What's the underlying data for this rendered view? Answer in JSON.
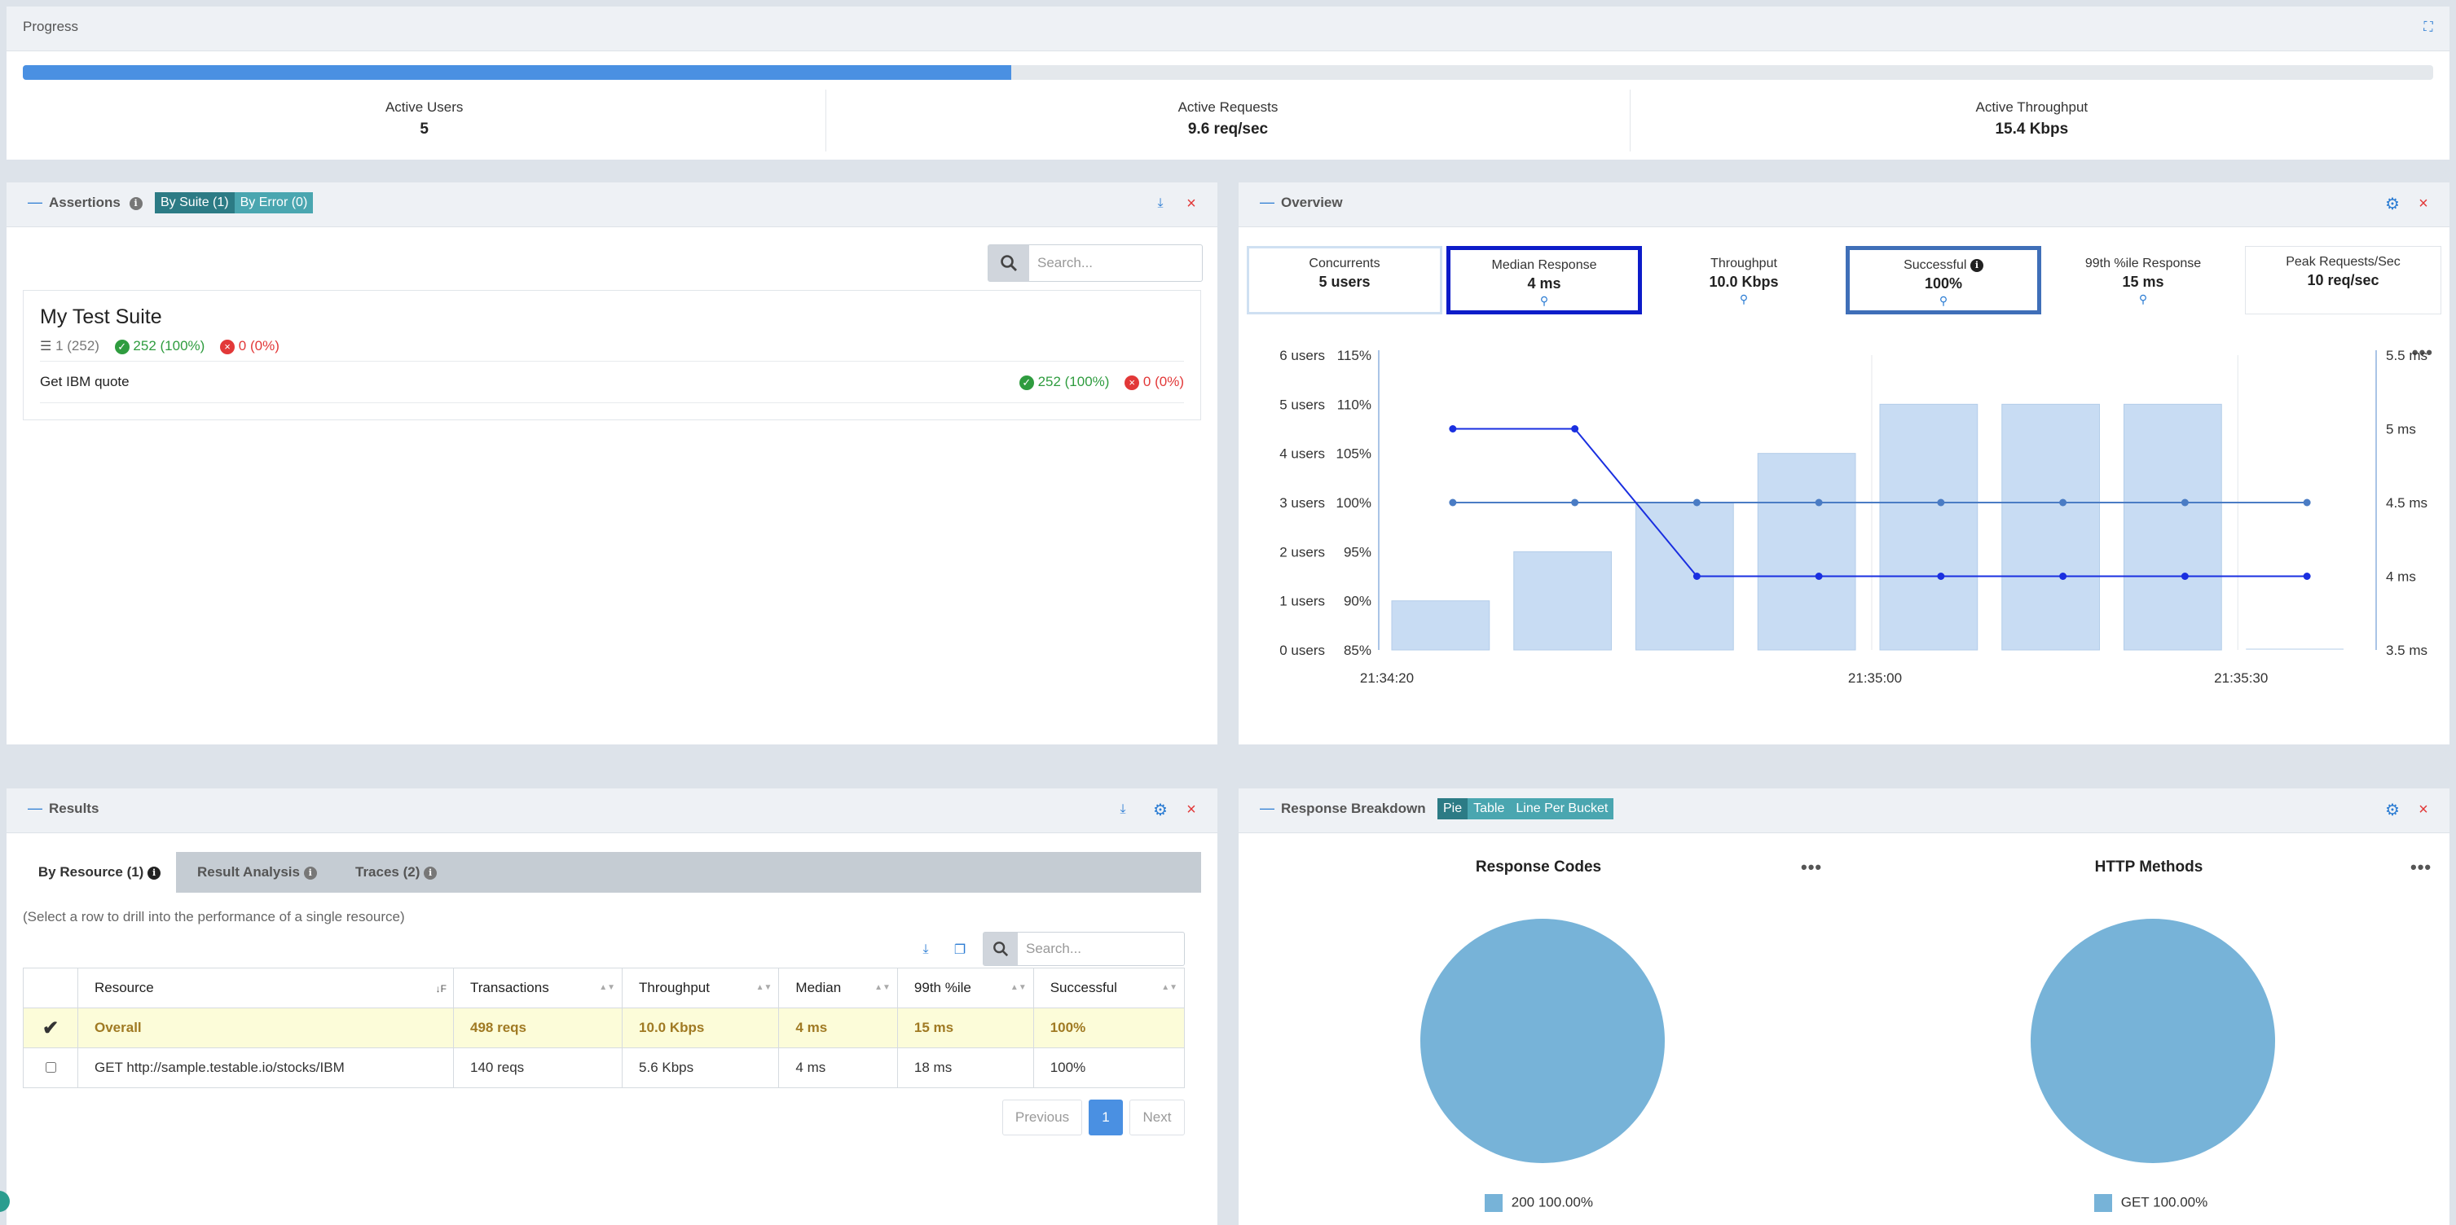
{
  "progress": {
    "title": "Progress",
    "fill_fraction": 0.41,
    "stats": [
      {
        "label": "Active Users",
        "value": "5"
      },
      {
        "label": "Active Requests",
        "value": "9.6 req/sec"
      },
      {
        "label": "Active Throughput",
        "value": "15.4 Kbps"
      }
    ]
  },
  "assertions": {
    "title": "Assertions",
    "toggle": [
      "By Suite (1)",
      "By Error (0)"
    ],
    "search_placeholder": "Search...",
    "suite": {
      "name": "My Test Suite",
      "count": "1 (252)",
      "pass": "252 (100%)",
      "fail": "0 (0%)"
    },
    "rows": [
      {
        "name": "Get IBM quote",
        "pass": "252 (100%)",
        "fail": "0 (0%)"
      }
    ]
  },
  "overview": {
    "title": "Overview",
    "cards": [
      {
        "label": "Concurrents",
        "value": "5 users",
        "magnify": false
      },
      {
        "label": "Median Response",
        "value": "4 ms",
        "magnify": true
      },
      {
        "label": "Throughput",
        "value": "10.0 Kbps",
        "magnify": true
      },
      {
        "label": "Successful",
        "value": "100%",
        "magnify": true
      },
      {
        "label": "99th %ile Response",
        "value": "15 ms",
        "magnify": true
      },
      {
        "label": "Peak Requests/Sec",
        "value": "10 req/sec",
        "magnify": false
      }
    ]
  },
  "chart_data": {
    "type": "bar",
    "x": [
      "21:34:20",
      "21:34:30",
      "21:34:40",
      "21:34:50",
      "21:35:00",
      "21:35:10",
      "21:35:20",
      "21:35:30"
    ],
    "x_tick_labels": [
      "21:34:20",
      "21:35:00",
      "21:35:30"
    ],
    "axes": {
      "users": {
        "ticks": [
          "0 users",
          "1 users",
          "2 users",
          "3 users",
          "4 users",
          "5 users",
          "6 users"
        ],
        "range": [
          0,
          6
        ]
      },
      "percent": {
        "ticks": [
          "85%",
          "90%",
          "95%",
          "100%",
          "105%",
          "110%",
          "115%"
        ],
        "range": [
          85,
          115
        ]
      },
      "ms": {
        "ticks": [
          "3.5 ms",
          "4 ms",
          "4.5 ms",
          "5 ms",
          "5.5 ms"
        ],
        "range": [
          3.5,
          5.5
        ]
      }
    },
    "series": [
      {
        "axis": "users",
        "kind": "bar",
        "values": [
          1,
          2,
          3,
          4,
          5,
          5,
          5,
          0
        ],
        "color": "#c8dcf3"
      },
      {
        "axis": "percent",
        "kind": "line",
        "values": [
          100,
          100,
          100,
          100,
          100,
          100,
          100,
          100
        ],
        "color": "#4a7cc4"
      },
      {
        "axis": "ms",
        "kind": "line",
        "values": [
          5,
          5,
          4,
          4,
          4,
          4,
          4,
          4
        ],
        "color": "#1a2fe0"
      }
    ],
    "grid": "vertical",
    "legend": "none"
  },
  "results": {
    "title": "Results",
    "tabs": [
      "By Resource (1)",
      "Result Analysis",
      "Traces (2)"
    ],
    "hint": "(Select a row to drill into the performance of a single resource)",
    "search_placeholder": "Search...",
    "columns": [
      "Resource",
      "Transactions",
      "Throughput",
      "Median",
      "99th %ile",
      "Successful"
    ],
    "rows": [
      {
        "resource": "Overall",
        "transactions": "498 reqs",
        "throughput": "10.0 Kbps",
        "median": "4 ms",
        "p99": "15 ms",
        "successful": "100%"
      },
      {
        "resource": "GET http://sample.testable.io/stocks/IBM",
        "transactions": "140 reqs",
        "throughput": "5.6 Kbps",
        "median": "4 ms",
        "p99": "18 ms",
        "successful": "100%"
      }
    ],
    "pagination": {
      "prev": "Previous",
      "page": "1",
      "next": "Next"
    }
  },
  "breakdown": {
    "title": "Response Breakdown",
    "toggle": [
      "Pie",
      "Table",
      "Line Per Bucket"
    ],
    "charts": [
      {
        "title": "Response Codes",
        "legend_label": "200",
        "legend_value": "100.00%",
        "color": "#77b3d8"
      },
      {
        "title": "HTTP Methods",
        "legend_label": "GET",
        "legend_value": "100.00%",
        "color": "#77b3d8"
      }
    ]
  },
  "colors": {
    "accent": "#2b7cd3",
    "danger": "#e23838",
    "teal": "#4aa6b0",
    "overall_row": "#fcfcd9"
  }
}
